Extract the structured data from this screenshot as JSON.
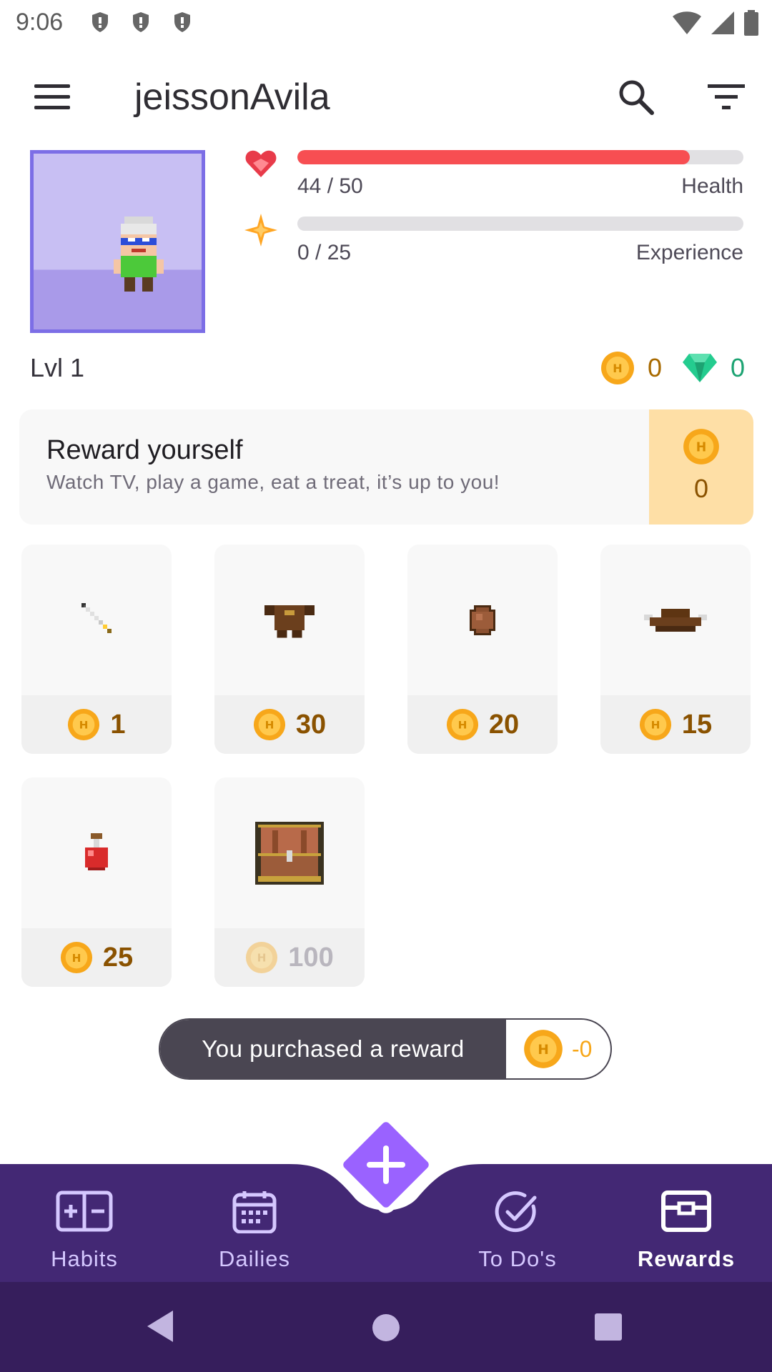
{
  "status_bar": {
    "time": "9:06"
  },
  "app_bar": {
    "title": "jeissonAvila"
  },
  "stats": {
    "health": {
      "value_text": "44 / 50",
      "label": "Health",
      "fraction": 0.88,
      "color": "#f74e52"
    },
    "experience": {
      "value_text": "0 / 25",
      "label": "Experience",
      "fraction": 0.0,
      "color": "#ffa624"
    }
  },
  "level_text": "Lvl 1",
  "currency": {
    "gold": "0",
    "gems": "0",
    "gold_color": "#a86a00",
    "gem_color": "#1ca372"
  },
  "reward_card": {
    "title": "Reward yourself",
    "subtitle": "Watch TV, play a game, eat a treat, it’s up to you!",
    "cost": "0"
  },
  "shop_items": [
    {
      "icon": "sword-icon",
      "price": "1"
    },
    {
      "icon": "armor-icon",
      "price": "30"
    },
    {
      "icon": "shield-icon",
      "price": "20"
    },
    {
      "icon": "hat-icon",
      "price": "15"
    },
    {
      "icon": "health-potion-icon",
      "price": "25"
    },
    {
      "icon": "treasure-chest-icon",
      "price": "100"
    }
  ],
  "snackbar": {
    "message": "You purchased a reward",
    "delta": "-0"
  },
  "bottom_nav": {
    "items": [
      {
        "label": "Habits",
        "icon": "habits-icon"
      },
      {
        "label": "Dailies",
        "icon": "calendar-icon"
      },
      {
        "label": "To Do's",
        "icon": "check-circle-icon"
      },
      {
        "label": "Rewards",
        "icon": "rewards-chest-icon",
        "active": true
      }
    ]
  },
  "colors": {
    "brand_purple": "#432874",
    "accent_purple": "#9a62ff",
    "gold": "#f7a71a"
  }
}
